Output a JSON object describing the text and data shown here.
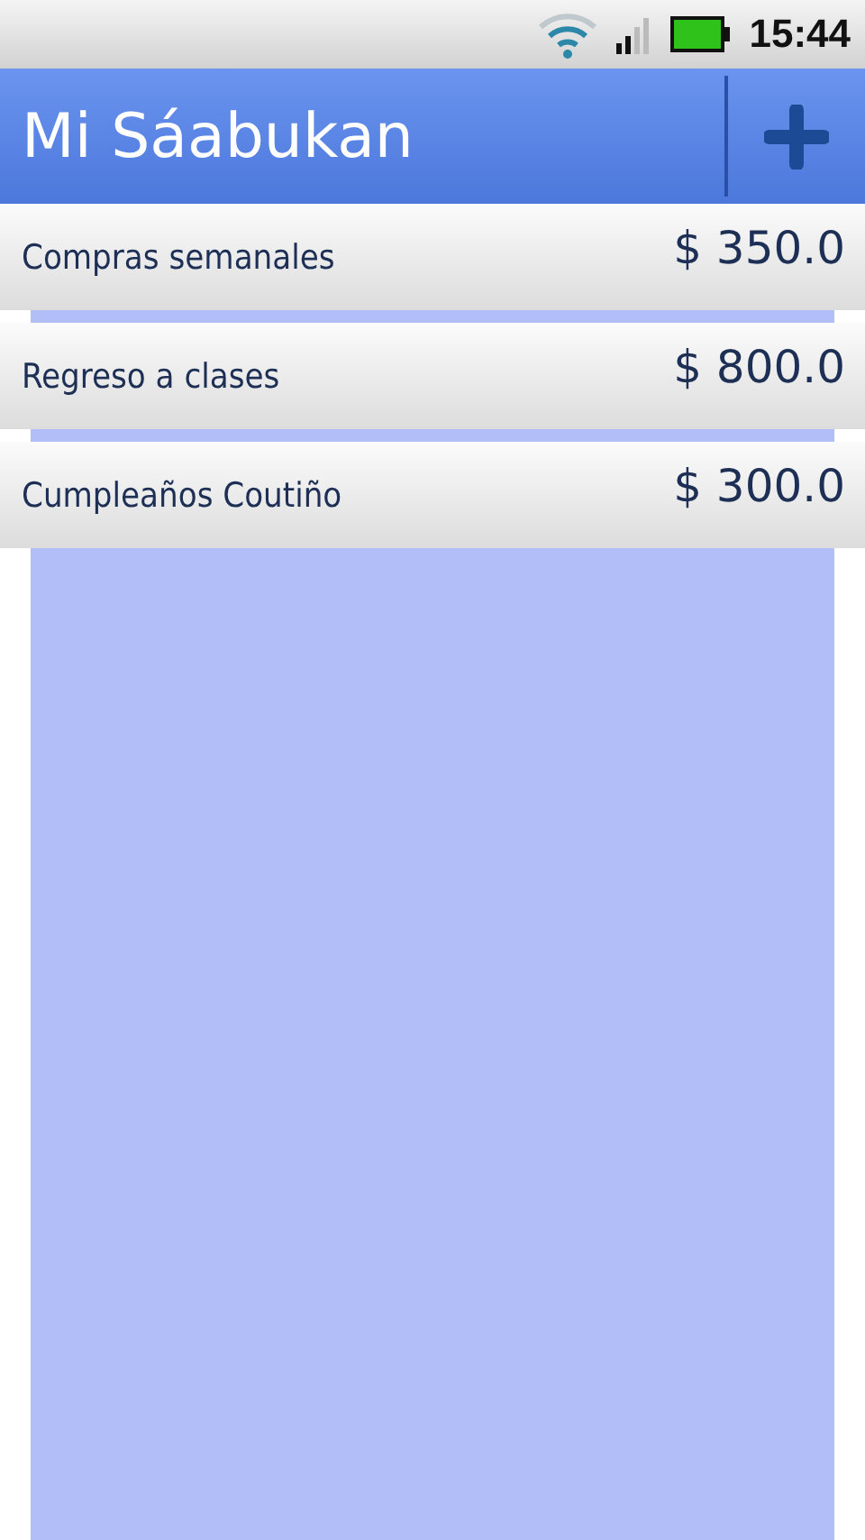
{
  "status_bar": {
    "time": "15:44"
  },
  "app_bar": {
    "title": "Mi Sáabukan"
  },
  "items": [
    {
      "name": "Compras semanales",
      "amount": "$ 350.0"
    },
    {
      "name": "Regreso a clases",
      "amount": "$ 800.0"
    },
    {
      "name": "Cumpleaños Coutiño",
      "amount": "$ 300.0"
    }
  ]
}
